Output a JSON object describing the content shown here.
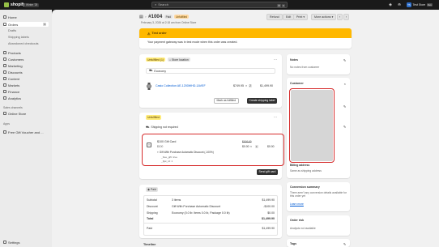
{
  "topbar": {
    "brand": "shopify",
    "season_badge": "Winter '25",
    "search_placeholder": "Search",
    "shortcut_keys": [
      "⌘",
      "K"
    ],
    "store_name": "Test Store",
    "store_initials": "TS",
    "store_tag": "Dev"
  },
  "sidebar": {
    "items": [
      {
        "label": "Home"
      },
      {
        "label": "Orders",
        "count": "3"
      },
      {
        "label": "Drafts"
      },
      {
        "label": "Shipping labels"
      },
      {
        "label": "Abandoned checkouts"
      },
      {
        "label": "Products"
      },
      {
        "label": "Customers"
      },
      {
        "label": "Marketing"
      },
      {
        "label": "Discounts"
      },
      {
        "label": "Content"
      },
      {
        "label": "Markets"
      },
      {
        "label": "Finance"
      },
      {
        "label": "Analytics"
      }
    ],
    "sales_channels_header": "Sales channels",
    "online_store": "Online Store",
    "apps_header": "Apps",
    "app_item": "Free Gift Voucher and ...",
    "settings": "Settings"
  },
  "order": {
    "title": "#1004",
    "paid_badge": "Paid",
    "fulfillment_badge": "Unfulfilled",
    "date": "February 3, 2026 at 2:18 am from Online Store",
    "actions": {
      "refund": "Refund",
      "edit": "Edit",
      "print": "Print",
      "more": "More actions"
    }
  },
  "test_banner": {
    "title": "Test order",
    "body": "Your payment gateway was in test mode when this order was created."
  },
  "fulfill_card": {
    "status": "Unfulfilled (1)",
    "location": "Store location",
    "shipping": "Economy",
    "item_name": "Casio Collection AE-1200WHD-1AVEF",
    "item_price": "$749.95",
    "qty_x": "×",
    "qty": "2",
    "item_total": "$1,499.90",
    "mark_fulfilled": "Mark as fulfilled",
    "create_label": "Create shipping label"
  },
  "gift_card": {
    "status": "Unfulfilled",
    "shipping_note": "Shipping not required",
    "name": "$100 Gift Card",
    "value": "$100",
    "discount": "Gift With Purchase Automatic Discount (-100%)",
    "prop1": "_free_gift: true",
    "prop2": "_fgw_id: 1",
    "orig_price": "$100.00",
    "price": "$0.00",
    "qty_x": "×",
    "qty": "1",
    "total": "$0.00",
    "send_btn": "Send gift card"
  },
  "payment": {
    "status": "Paid",
    "rows": [
      {
        "label": "Subtotal",
        "desc": "3 items",
        "amount": "$1,499.90"
      },
      {
        "label": "Discount",
        "desc": "Gift With Purchase Automatic Discount",
        "amount": "-$100.00"
      },
      {
        "label": "Shipping",
        "desc": "Economy (0.0 lb: Items 0.0 lb, Package 0.0 lb)",
        "amount": "$0.00"
      },
      {
        "label": "Total",
        "desc": "",
        "amount": "$1,499.90"
      }
    ],
    "paid_label": "Paid",
    "paid_amount": "$1,499.90"
  },
  "timeline": {
    "title": "Timeline"
  },
  "right": {
    "notes_title": "Notes",
    "notes_body": "No notes from customer",
    "customer_title": "Customer",
    "billing_title": "Billing address",
    "billing_body": "Same as shipping address",
    "conversion_title": "Conversion summary",
    "conversion_body": "There aren't any conversion details available for this order yet",
    "learn_more": "Learn more",
    "risk_title": "Order risk",
    "risk_body": "Analysis not available",
    "tags_title": "Tags"
  },
  "colors": {
    "accent_red_outline": "#d62c2c",
    "warning_banner": "#ffb800",
    "unfulfilled_badge": "#ffeb78",
    "brand_green": "#95bf47"
  }
}
